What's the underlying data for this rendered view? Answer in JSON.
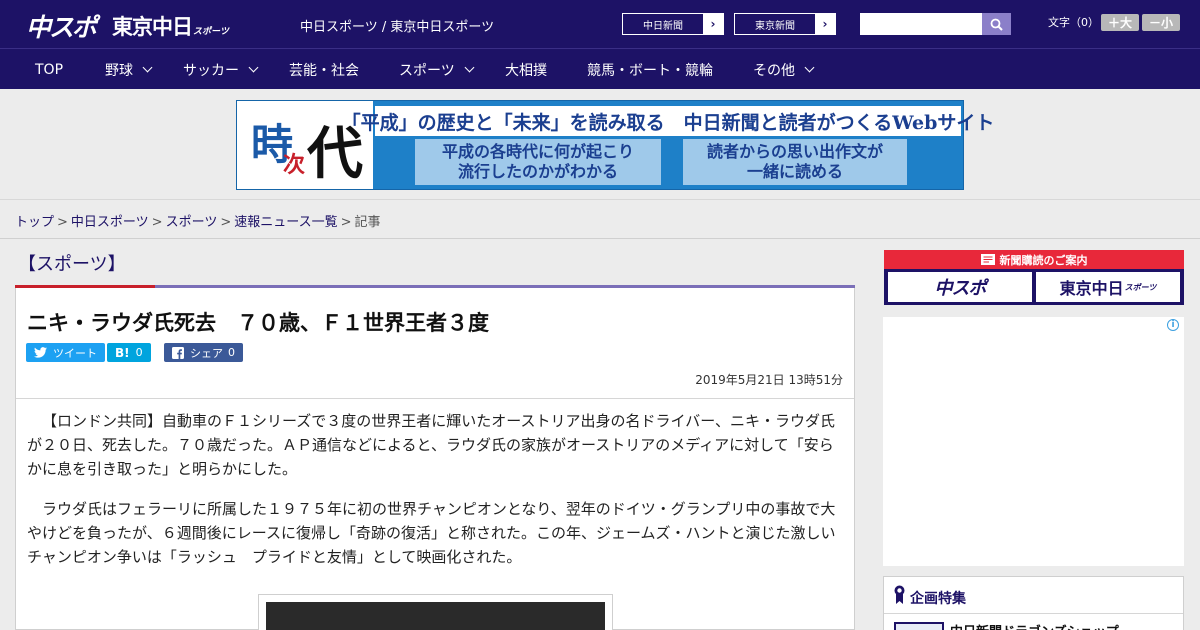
{
  "header": {
    "logo_main": "中スポ",
    "logo_tokyo": "東京中日",
    "logo_tokyo_small": "スポーツ",
    "site_links": "中日スポーツ / 東京中日スポーツ",
    "buttons": [
      {
        "label": "中日新聞",
        "arrow": "›"
      },
      {
        "label": "東京新聞",
        "arrow": "›"
      }
    ],
    "search": {
      "value": "",
      "placeholder": ""
    },
    "font_size_label": "文字（0）",
    "font_plus": "＋大",
    "font_minus": "－小"
  },
  "nav": {
    "items": [
      {
        "label": "TOP",
        "has_dropdown": false
      },
      {
        "label": "野球",
        "has_dropdown": true
      },
      {
        "label": "サッカー",
        "has_dropdown": true
      },
      {
        "label": "芸能・社会",
        "has_dropdown": false
      },
      {
        "label": "スポーツ",
        "has_dropdown": true
      },
      {
        "label": "大相撲",
        "has_dropdown": false
      },
      {
        "label": "競馬・ボート・競輪",
        "has_dropdown": false
      },
      {
        "label": "その他",
        "has_dropdown": true
      }
    ]
  },
  "banner": {
    "kanji_1": "時",
    "kanji_2": "次",
    "kanji_3": "代",
    "headline": "「平成」の歴史と「未来」を読み取る　中日新聞と読者がつくるWebサイト",
    "box_left_line1": "平成の各時代に何が起こり",
    "box_left_line2": "流行したのかがわかる",
    "box_right_line1": "読者からの思い出作文が",
    "box_right_line2": "一緒に読める"
  },
  "breadcrumb": {
    "items": [
      "トップ",
      "中日スポーツ",
      "スポーツ",
      "速報ニュース一覧"
    ],
    "current": "記事",
    "separator": ">"
  },
  "article": {
    "section": "【スポーツ】",
    "title": "ニキ・ラウダ氏死去　７０歳、Ｆ１世界王者３度",
    "share": {
      "tweet_label": "ツイート",
      "hatena_icon": "B!",
      "hatena_count": "0",
      "fb_label": "シェア",
      "fb_count": "0"
    },
    "date": "2019年5月21日 13時51分",
    "paragraphs": [
      "【ロンドン共同】自動車のＦ１シリーズで３度の世界王者に輝いたオーストリア出身の名ドライバー、ニキ・ラウダ氏が２０日、死去した。７０歳だった。ＡＰ通信などによると、ラウダ氏の家族がオーストリアのメディアに対して「安らかに息を引き取った」と明らかにした。",
      "ラウダ氏はフェラーリに所属した１９７５年に初の世界チャンピオンとなり、翌年のドイツ・グランプリ中の事故で大やけどを負ったが、６週間後にレースに復帰し「奇跡の復活」と称された。この年、ジェームズ・ハントと演じた激しいチャンピオン争いは「ラッシュ　プライドと友情」として映画化された。"
    ]
  },
  "sidebar": {
    "subscribe_head": "新聞購読のご案内",
    "subscribe_buttons": [
      "中スポ",
      "東京中日"
    ],
    "subscribe_small": "スポーツ",
    "ad_info": "i",
    "feature_title": "企画特集",
    "feature_item": "中日新聞ドラゴンズショップ"
  },
  "colors": {
    "brand_navy": "#1d1266",
    "accent_red": "#c8202b",
    "twitter": "#1da1f2",
    "hatena": "#00a4de",
    "facebook": "#3b5998"
  }
}
